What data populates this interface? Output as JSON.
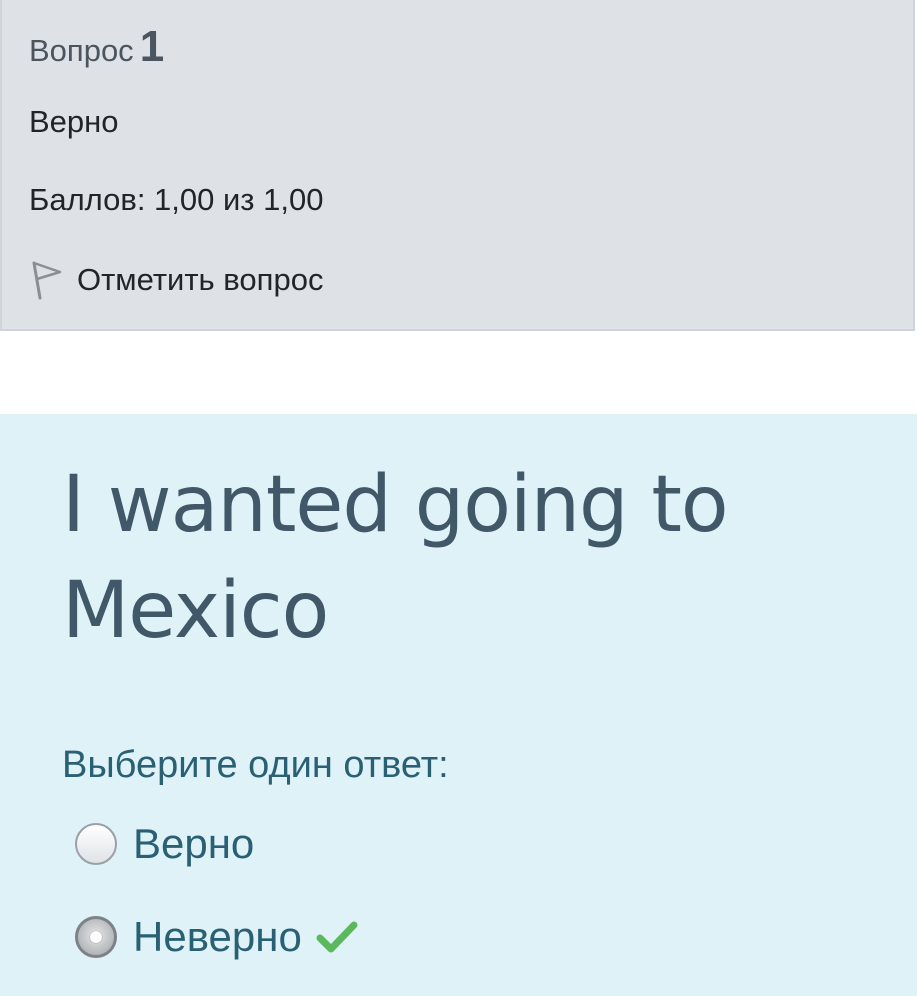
{
  "info": {
    "question_word": "Вопрос",
    "question_number": "1",
    "state": "Верно",
    "grade": "Баллов: 1,00 из 1,00",
    "flag_label": "Отметить вопрос",
    "flag_icon": "flag-icon"
  },
  "question": {
    "text": "I wanted going to Mexico",
    "prompt": "Выберите один ответ:",
    "options": [
      {
        "label": "Верно",
        "selected": false
      },
      {
        "label": "Неверно",
        "selected": true,
        "status_icon": "checkmark-icon"
      }
    ]
  },
  "colors": {
    "info_background": "#dee2e6",
    "content_background": "#def2f8",
    "text_dark": "#212529",
    "question_text": "#415868",
    "answer_text": "#2a6074",
    "correct_green": "#5cb85c"
  }
}
